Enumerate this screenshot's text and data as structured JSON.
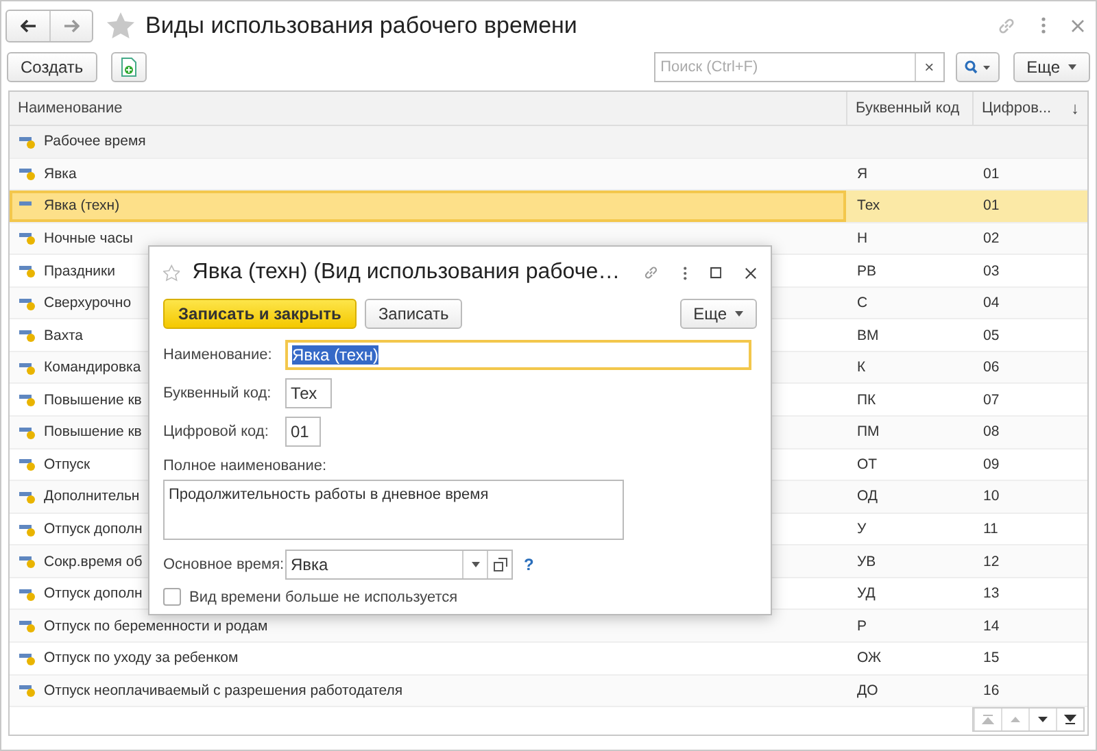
{
  "window": {
    "title": "Виды использования рабочего времени"
  },
  "toolbar": {
    "create_button": "Создать",
    "search": {
      "placeholder": "Поиск (Ctrl+F)",
      "clear": "×"
    },
    "more_button": "Еще"
  },
  "table": {
    "columns": [
      "Наименование",
      "Буквенный код",
      "Цифров..."
    ],
    "sort_mark": "↓",
    "rows": [
      {
        "kind": "group",
        "name": "Рабочее время",
        "letter_code": "",
        "digit_code": "",
        "selected": false
      },
      {
        "kind": "item",
        "name": "Явка",
        "letter_code": "Я",
        "digit_code": "01",
        "selected": false
      },
      {
        "kind": "item",
        "name": "Явка (техн)",
        "letter_code": "Тех",
        "digit_code": "01",
        "selected": true
      },
      {
        "kind": "item",
        "name": "Ночные часы",
        "letter_code": "Н",
        "digit_code": "02",
        "selected": false
      },
      {
        "kind": "item",
        "name": "Праздники",
        "letter_code": "РВ",
        "digit_code": "03",
        "selected": false
      },
      {
        "kind": "item",
        "name": "Сверхурочно",
        "letter_code": "С",
        "digit_code": "04",
        "selected": false
      },
      {
        "kind": "item",
        "name": "Вахта",
        "letter_code": "ВМ",
        "digit_code": "05",
        "selected": false
      },
      {
        "kind": "item",
        "name": "Командировка",
        "letter_code": "К",
        "digit_code": "06",
        "selected": false
      },
      {
        "kind": "item",
        "name": "Повышение кв",
        "letter_code": "ПК",
        "digit_code": "07",
        "selected": false
      },
      {
        "kind": "item",
        "name": "Повышение кв",
        "letter_code": "ПМ",
        "digit_code": "08",
        "selected": false
      },
      {
        "kind": "item",
        "name": "Отпуск",
        "letter_code": "ОТ",
        "digit_code": "09",
        "selected": false
      },
      {
        "kind": "item",
        "name": "Дополнительн",
        "letter_code": "ОД",
        "digit_code": "10",
        "selected": false
      },
      {
        "kind": "item",
        "name": "Отпуск дополн",
        "letter_code": "У",
        "digit_code": "11",
        "selected": false
      },
      {
        "kind": "item",
        "name": "Сокр.время об",
        "letter_code": "УВ",
        "digit_code": "12",
        "selected": false
      },
      {
        "kind": "item",
        "name": "Отпуск дополн",
        "letter_code": "УД",
        "digit_code": "13",
        "selected": false
      },
      {
        "kind": "item",
        "name": "Отпуск по беременности и родам",
        "letter_code": "Р",
        "digit_code": "14",
        "selected": false
      },
      {
        "kind": "item",
        "name": "Отпуск по уходу за ребенком",
        "letter_code": "ОЖ",
        "digit_code": "15",
        "selected": false
      },
      {
        "kind": "item",
        "name": "Отпуск неоплачиваемый с разрешения работодателя",
        "letter_code": "ДО",
        "digit_code": "16",
        "selected": false
      }
    ]
  },
  "dialog": {
    "title": "Явка (техн) (Вид использования рабоче…",
    "save_close_button": "Записать и закрыть",
    "save_button": "Записать",
    "more_button": "Еще",
    "name": {
      "label": "Наименование:",
      "value": "Явка (техн)"
    },
    "letter_code": {
      "label": "Буквенный код:",
      "value": "Тех"
    },
    "digit_code": {
      "label": "Цифровой код:",
      "value": "01"
    },
    "full_name": {
      "label": "Полное наименование:",
      "value": "Продолжительность работы в дневное время"
    },
    "main_time": {
      "label": "Основное время:",
      "value": "Явка",
      "help": "?"
    },
    "unused": {
      "label": "Вид времени больше не используется",
      "checked": false
    }
  }
}
